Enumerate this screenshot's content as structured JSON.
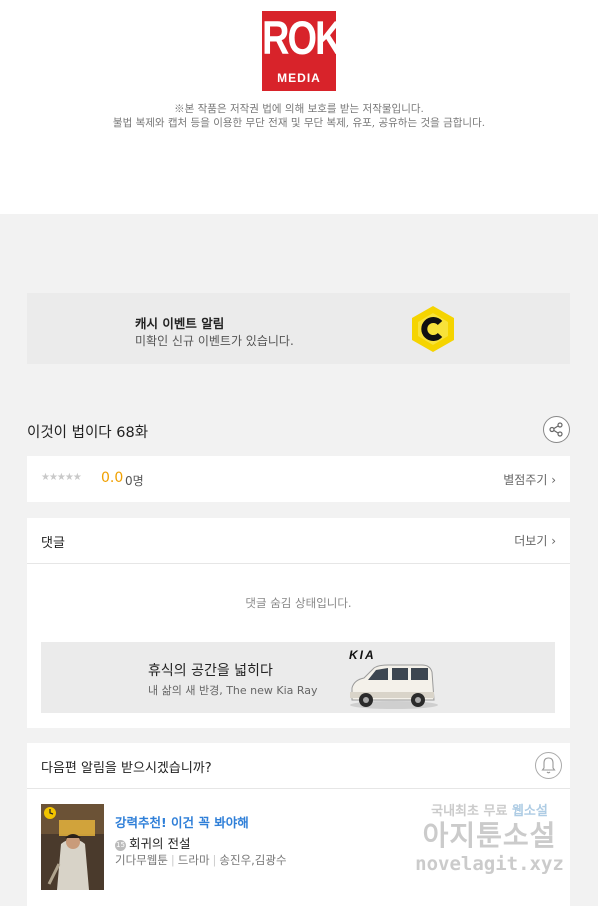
{
  "brand": {
    "logo_top": "ROK",
    "logo_bottom": "MEDIA"
  },
  "copyright_notice": {
    "line1": "※본 작품은 저작권 법에 의해 보호를 받는 저작물입니다.",
    "line2": "불법 복제와 캡처 등을 이용한 무단 전재 및 무단 복제, 유포, 공유하는 것을 금합니다."
  },
  "cash_event": {
    "title": "캐시 이벤트 알림",
    "subtitle": "미확인 신규 이벤트가 있습니다.",
    "icon": "cash-coin-icon"
  },
  "episode": {
    "title": "이것이 법이다 68화",
    "share_icon": "share-icon"
  },
  "rating": {
    "stars": "★★★★★",
    "score": "0.0",
    "count": "0명",
    "rate_label": "별점주기 ›"
  },
  "comments": {
    "title": "댓글",
    "more_label": "더보기 ›",
    "hidden_message": "댓글 숨김 상태입니다."
  },
  "ad": {
    "headline": "휴식의 공간을 넓히다",
    "subline": "내 삶의 새 반경, The new Kia Ray",
    "brand": "KIA"
  },
  "next_alert": {
    "question": "다음편 알림을 받으시겠습니까?",
    "bell_icon": "bell-icon",
    "recommend_label": "강력추천! 이건 꼭 봐야해",
    "age_badge": "15",
    "work_title": "회귀의 전설",
    "genre": "기다무웹툰",
    "category": "드라마",
    "authors": "송진우,김광수",
    "separator": "|"
  },
  "watermark": {
    "line1_a": "국내최초 무료 ",
    "line1_b": "웹소설",
    "line2": "아지툰소설",
    "line3": "novelagit.xyz"
  },
  "colors": {
    "brand_red": "#d8232a",
    "score_orange": "#f0a000",
    "link_blue": "#2f7fd8",
    "coin_yellow": "#f5d400"
  }
}
